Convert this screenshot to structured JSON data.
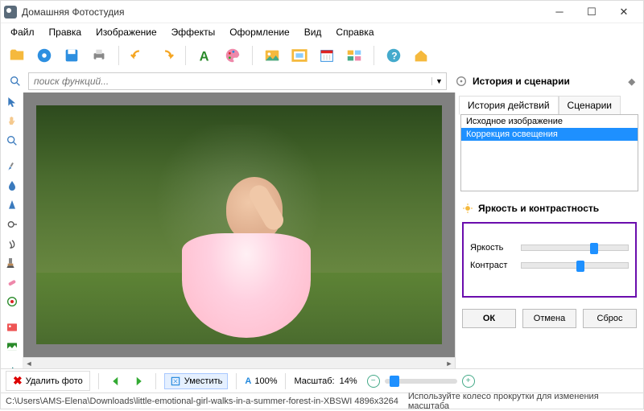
{
  "window": {
    "title": "Домашняя Фотостудия"
  },
  "menu": [
    "Файл",
    "Правка",
    "Изображение",
    "Эффекты",
    "Оформление",
    "Вид",
    "Справка"
  ],
  "search": {
    "placeholder": "поиск функций..."
  },
  "right": {
    "header": "История и сценарии",
    "tabs": {
      "history": "История действий",
      "scenarios": "Сценарии"
    },
    "history_rows": [
      "Исходное изображение",
      "Коррекция освещения"
    ],
    "panel_title": "Яркость и контрастность",
    "sliders": {
      "brightness": {
        "label": "Яркость",
        "value": 68
      },
      "contrast": {
        "label": "Контраст",
        "value": 55
      }
    },
    "buttons": {
      "ok": "ОК",
      "cancel": "Отмена",
      "reset": "Сброс"
    }
  },
  "bottom": {
    "delete": "Удалить фото",
    "fit": "Уместить",
    "scale_A": "100%",
    "scale_label": "Масштаб:",
    "scale_value": "14%"
  },
  "status": {
    "path": "C:\\Users\\AMS-Elena\\Downloads\\little-emotional-girl-walks-in-a-summer-forest-in-XBSWI 4896x3264",
    "hint": "Используйте колесо прокрутки для изменения масштаба"
  }
}
